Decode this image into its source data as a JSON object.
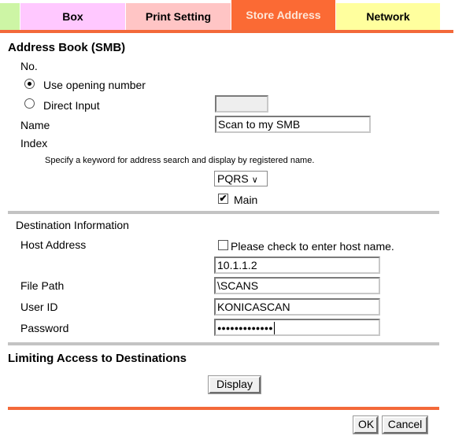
{
  "tabs": [
    {
      "label": "",
      "color": "#cdf5a5"
    },
    {
      "label": "Box",
      "color": "#ffc8ff"
    },
    {
      "label": "Print Setting",
      "color": "#ffc5c5"
    },
    {
      "label": "Store Address",
      "color": "#fb6a34",
      "active": true
    },
    {
      "label": "Network",
      "color": "#ffff9e"
    }
  ],
  "address_book": {
    "title": "Address Book (SMB)",
    "no_label": "No.",
    "use_opening_number": {
      "label": "Use opening number",
      "selected": true
    },
    "direct_input": {
      "label": "Direct Input",
      "selected": false,
      "value": ""
    },
    "name_label": "Name",
    "name_value": "Scan to my SMB",
    "index_label": "Index",
    "index_hint": "Specify a keyword for address search and display by registered name.",
    "index_select": "PQRS",
    "main_checkbox": {
      "label": "Main",
      "checked": true
    }
  },
  "destination": {
    "title": "Destination Information",
    "host_address_label": "Host Address",
    "host_name_checkbox": {
      "label": "Please check to enter host name.",
      "checked": false
    },
    "host_address_value": "10.1.1.2",
    "file_path_label": "File Path",
    "file_path_value": "\\SCANS",
    "user_id_label": "User ID",
    "user_id_value": "KONICASCAN",
    "password_label": "Password",
    "password_masked": "●●●●●●●●●●●●●"
  },
  "limiting": {
    "title": "Limiting Access to Destinations",
    "display_button": "Display"
  },
  "footer": {
    "ok_button": "OK",
    "cancel_button": "Cancel"
  },
  "colors": {
    "accent": "#f3693a",
    "divider": "#c3c3c3"
  }
}
